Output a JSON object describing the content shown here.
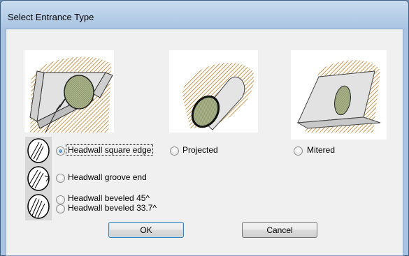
{
  "window": {
    "title": "Select Entrance Type"
  },
  "options": [
    {
      "label": "Headwall square edge",
      "selected": true
    },
    {
      "label": "Projected",
      "selected": false
    },
    {
      "label": "Mitered",
      "selected": false
    },
    {
      "label": "Headwall groove end",
      "selected": false
    },
    {
      "label": "Headwall beveled 45^",
      "selected": false
    },
    {
      "label": "Headwall beveled 33.7^",
      "selected": false
    }
  ],
  "buttons": {
    "ok": "OK",
    "cancel": "Cancel"
  },
  "colors": {
    "hatch": "#c89a57",
    "pipe_fill": "#aab38a",
    "pipe_fill_light": "#c6c9a5"
  }
}
